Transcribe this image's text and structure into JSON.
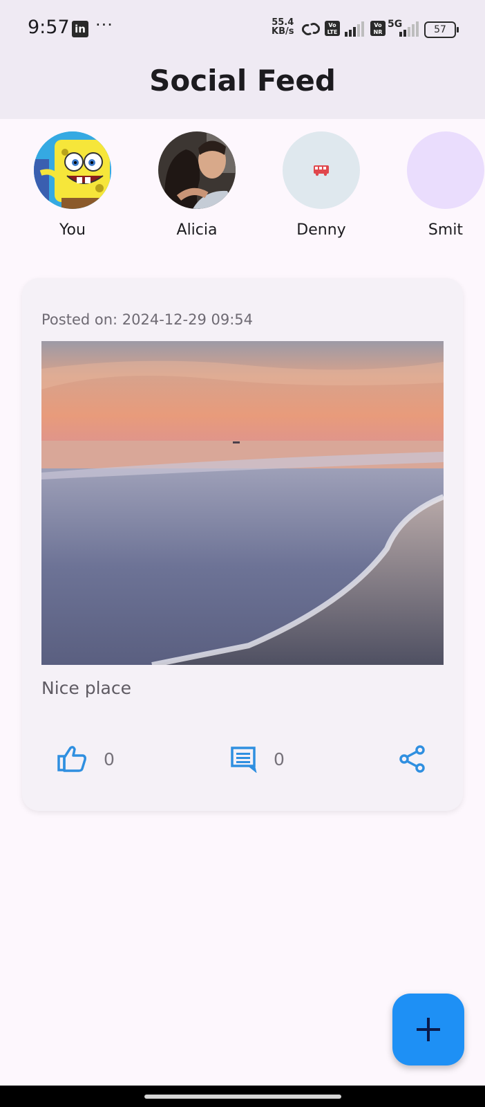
{
  "status_bar": {
    "time": "9:57",
    "linkedin_icon": "linkedin-icon",
    "more_notifications": "···",
    "net_speed_value": "55.4",
    "net_speed_unit": "KB/s",
    "volte_label_1": "Vo LTE",
    "volte_label_2": "Vo NR",
    "network_type": "5G",
    "battery": "57"
  },
  "app_bar": {
    "title": "Social Feed"
  },
  "stories": [
    {
      "name": "You",
      "avatar": "spongebob-avatar"
    },
    {
      "name": "Alicia",
      "avatar": "couple-photo-avatar"
    },
    {
      "name": "Denny",
      "avatar": "bus-icon-avatar"
    },
    {
      "name": "Smit",
      "avatar": "blank-avatar"
    }
  ],
  "post": {
    "posted_on": "Posted on: 2024-12-29 09:54",
    "image": "beach-sunset-photo",
    "caption": "Nice place",
    "likes": "0",
    "comments": "0"
  },
  "fab": {
    "icon": "plus-icon"
  },
  "colors": {
    "accent": "#1e90f5",
    "app_bar_bg": "#efeaf3",
    "page_bg": "#fdf7fd",
    "card_bg": "#f5f1f7",
    "icon_blue": "#2f8fe0",
    "bus_red": "#e0474c"
  }
}
